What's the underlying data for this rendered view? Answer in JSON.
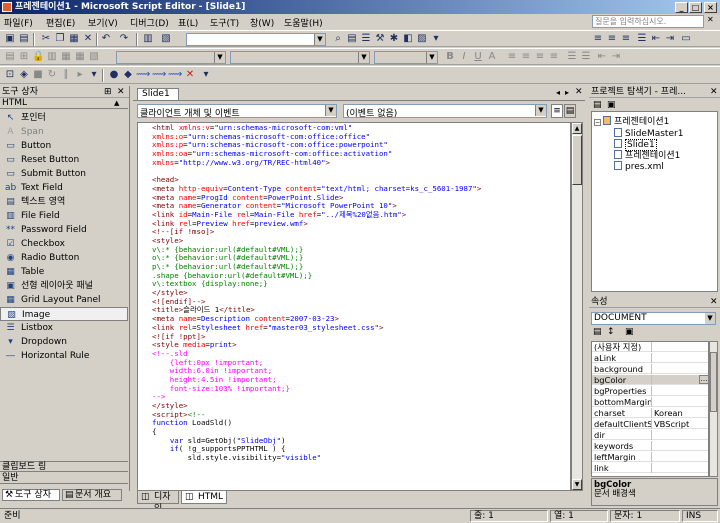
{
  "window": {
    "title": "프레젠테이션1 - Microsoft Script Editor - [Slide1]",
    "controls": {
      "min": "_",
      "max": "□",
      "close": "×"
    }
  },
  "menu": {
    "items": [
      "파일(F)",
      "편집(E)",
      "보기(V)",
      "디버그(D)",
      "표(L)",
      "도구(T)",
      "창(W)",
      "도움말(H)"
    ],
    "help_placeholder": "질문을 입력하십시오."
  },
  "toolbox": {
    "title": "도구 상자",
    "category": "HTML",
    "tools": [
      "포인터",
      "Span",
      "Button",
      "Reset Button",
      "Submit Button",
      "Text Field",
      "텍스트 영역",
      "File Field",
      "Password Field",
      "Checkbox",
      "Radio Button",
      "Table",
      "선형 레이아웃 패널",
      "Grid Layout Panel",
      "Image",
      "Listbox",
      "Dropdown",
      "Horizontal Rule"
    ],
    "selected": "Image",
    "clipboard": "클립보드 링",
    "general": "일반",
    "tab_toolbox": "도구 상자",
    "tab_outline": "문서 개요"
  },
  "editor": {
    "doc_tab": "Slide1",
    "object_combo": "클라이언트 개체 및 이벤트",
    "event_combo": "(이벤트 없음)",
    "bottom_tabs": {
      "design": "디자인",
      "html": "HTML"
    },
    "code": [
      [
        [
          "c-tag",
          "<html "
        ],
        [
          "c-att",
          "xmlns:v"
        ],
        [
          "c-blk",
          "="
        ],
        [
          "c-val",
          "\"urn:schemas-microsoft-com:vml\""
        ]
      ],
      [
        [
          "c-att",
          "xmlns:o"
        ],
        [
          "c-blk",
          "="
        ],
        [
          "c-val",
          "\"urn:schemas-microsoft-com:office:office\""
        ]
      ],
      [
        [
          "c-att",
          "xmlns:p"
        ],
        [
          "c-blk",
          "="
        ],
        [
          "c-val",
          "\"urn:schemas-microsoft-com:office:powerpoint\""
        ]
      ],
      [
        [
          "c-att",
          "xmlns:oa"
        ],
        [
          "c-blk",
          "="
        ],
        [
          "c-val",
          "\"urn:schemas-microsoft-com:office:activation\""
        ]
      ],
      [
        [
          "c-att",
          "xmlns"
        ],
        [
          "c-blk",
          "="
        ],
        [
          "c-val",
          "\"http://www.w3.org/TR/REC-html40\""
        ],
        [
          "c-tag",
          ">"
        ]
      ],
      [
        [
          "c-blk",
          ""
        ]
      ],
      [
        [
          "c-tag",
          "<head>"
        ]
      ],
      [
        [
          "c-tag",
          "<meta "
        ],
        [
          "c-att",
          "http-equiv"
        ],
        [
          "c-blk",
          "="
        ],
        [
          "c-val",
          "Content-Type "
        ],
        [
          "c-att",
          "content"
        ],
        [
          "c-blk",
          "="
        ],
        [
          "c-val",
          "\"text/html; charset=ks_c_5601-1987\""
        ],
        [
          "c-tag",
          ">"
        ]
      ],
      [
        [
          "c-tag",
          "<meta "
        ],
        [
          "c-att",
          "name"
        ],
        [
          "c-blk",
          "="
        ],
        [
          "c-val",
          "ProgId "
        ],
        [
          "c-att",
          "content"
        ],
        [
          "c-blk",
          "="
        ],
        [
          "c-val",
          "PowerPoint.Slide"
        ],
        [
          "c-tag",
          ">"
        ]
      ],
      [
        [
          "c-tag",
          "<meta "
        ],
        [
          "c-att",
          "name"
        ],
        [
          "c-blk",
          "="
        ],
        [
          "c-val",
          "Generator "
        ],
        [
          "c-att",
          "content"
        ],
        [
          "c-blk",
          "="
        ],
        [
          "c-val",
          "\"Microsoft PowerPoint 10\""
        ],
        [
          "c-tag",
          ">"
        ]
      ],
      [
        [
          "c-tag",
          "<link "
        ],
        [
          "c-att",
          "id"
        ],
        [
          "c-blk",
          "="
        ],
        [
          "c-val",
          "Main-File "
        ],
        [
          "c-att",
          "rel"
        ],
        [
          "c-blk",
          "="
        ],
        [
          "c-val",
          "Main-File "
        ],
        [
          "c-att",
          "href"
        ],
        [
          "c-blk",
          "="
        ],
        [
          "c-val",
          "\"../제목%20없음.htm\""
        ],
        [
          "c-tag",
          ">"
        ]
      ],
      [
        [
          "c-tag",
          "<link "
        ],
        [
          "c-att",
          "rel"
        ],
        [
          "c-blk",
          "="
        ],
        [
          "c-val",
          "Preview "
        ],
        [
          "c-att",
          "href"
        ],
        [
          "c-blk",
          "="
        ],
        [
          "c-val",
          "preview.wmf"
        ],
        [
          "c-tag",
          ">"
        ]
      ],
      [
        [
          "c-tag",
          "<!--[if !mso]>"
        ]
      ],
      [
        [
          "c-tag",
          "<style>"
        ]
      ],
      [
        [
          "c-grn",
          "v\\:* {behavior:url(#default#VML);}"
        ]
      ],
      [
        [
          "c-grn",
          "o\\:* {behavior:url(#default#VML);}"
        ]
      ],
      [
        [
          "c-grn",
          "p\\:* {behavior:url(#default#VML);}"
        ]
      ],
      [
        [
          "c-grn",
          ".shape {behavior:url(#default#VML);}"
        ]
      ],
      [
        [
          "c-grn",
          "v\\:textbox {display:none;}"
        ]
      ],
      [
        [
          "c-tag",
          "</style>"
        ]
      ],
      [
        [
          "c-tag",
          "<![endif]-->"
        ]
      ],
      [
        [
          "c-tag",
          "<title>"
        ],
        [
          "c-blk",
          "슬라이드 1"
        ],
        [
          "c-tag",
          "</title>"
        ]
      ],
      [
        [
          "c-tag",
          "<meta "
        ],
        [
          "c-att",
          "name"
        ],
        [
          "c-blk",
          "="
        ],
        [
          "c-val",
          "Description "
        ],
        [
          "c-att",
          "content"
        ],
        [
          "c-blk",
          "="
        ],
        [
          "c-val",
          "2007-03-23"
        ],
        [
          "c-tag",
          ">"
        ]
      ],
      [
        [
          "c-tag",
          "<link "
        ],
        [
          "c-att",
          "rel"
        ],
        [
          "c-blk",
          "="
        ],
        [
          "c-val",
          "Stylesheet "
        ],
        [
          "c-att",
          "href"
        ],
        [
          "c-blk",
          "="
        ],
        [
          "c-val",
          "\"master03_stylesheet.css\""
        ],
        [
          "c-tag",
          ">"
        ]
      ],
      [
        [
          "c-tag",
          "<![if !ppt]>"
        ]
      ],
      [
        [
          "c-tag",
          "<style "
        ],
        [
          "c-att",
          "media"
        ],
        [
          "c-blk",
          "="
        ],
        [
          "c-val",
          "print"
        ],
        [
          "c-tag",
          ">"
        ]
      ],
      [
        [
          "c-mag",
          "<!--.sld"
        ]
      ],
      [
        [
          "c-mag",
          "    {left:0px !important;"
        ]
      ],
      [
        [
          "c-mag",
          "    width:6.0in !important;"
        ]
      ],
      [
        [
          "c-mag",
          "    height:4.5in !important;"
        ]
      ],
      [
        [
          "c-mag",
          "    font-size:103% !important;}"
        ]
      ],
      [
        [
          "c-mag",
          "-->"
        ]
      ],
      [
        [
          "c-tag",
          "</style>"
        ]
      ],
      [
        [
          "c-tag",
          "<script>"
        ],
        [
          "c-grn",
          "<!--"
        ]
      ],
      [
        [
          "c-kw",
          "function "
        ],
        [
          "c-blk",
          "LoadSld()"
        ]
      ],
      [
        [
          "c-blk",
          "{"
        ]
      ],
      [
        [
          "c-blk",
          "    "
        ],
        [
          "c-kw",
          "var "
        ],
        [
          "c-blk",
          "sld=GetObj("
        ],
        [
          "c-val",
          "\"SlideObj\""
        ],
        [
          "c-blk",
          ")"
        ]
      ],
      [
        [
          "c-blk",
          "    "
        ],
        [
          "c-kw",
          "if"
        ],
        [
          "c-blk",
          "( !g_supportsPPTHTML ) {"
        ]
      ],
      [
        [
          "c-blk",
          "        sld.style.visibility="
        ],
        [
          "c-val",
          "\"visible\""
        ]
      ]
    ]
  },
  "project": {
    "title": "프로젝트 탐색기 - 프레...",
    "root": "프레젠테이션1",
    "items": [
      "SlideMaster1",
      "Slide1",
      "프레젠테이션1",
      "pres.xml"
    ]
  },
  "properties": {
    "title": "속성",
    "object": "DOCUMENT",
    "rows": [
      [
        "(사용자 지정)",
        ""
      ],
      [
        "aLink",
        ""
      ],
      [
        "background",
        ""
      ],
      [
        "bgColor",
        ""
      ],
      [
        "bgProperties",
        ""
      ],
      [
        "bottomMargin",
        ""
      ],
      [
        "charset",
        "Korean"
      ],
      [
        "defaultClientSc",
        "VBScript"
      ],
      [
        "dir",
        ""
      ],
      [
        "keywords",
        ""
      ],
      [
        "leftMargin",
        ""
      ],
      [
        "link",
        ""
      ]
    ],
    "selected": "bgColor",
    "desc_title": "bgColor",
    "desc_text": "문서 배경색"
  },
  "status": {
    "ready": "준비",
    "line": "줄: 1",
    "col": "열: 1",
    "char": "문자: 1",
    "ins": "INS"
  }
}
